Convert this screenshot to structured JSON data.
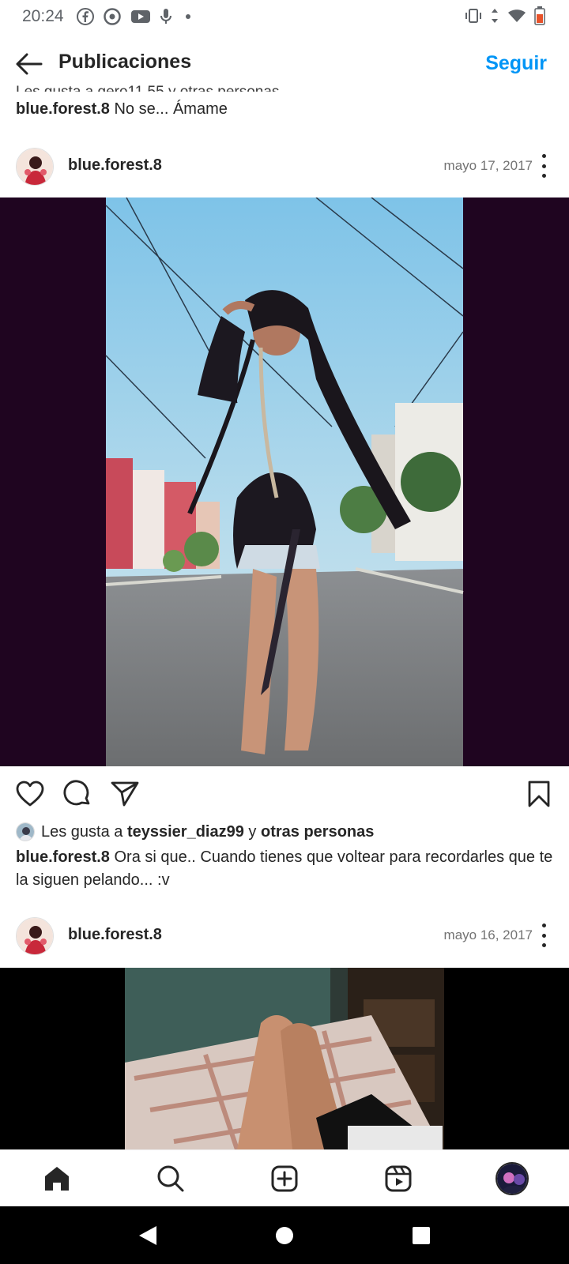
{
  "status_bar": {
    "time": "20:24"
  },
  "header": {
    "title": "Publicaciones",
    "follow_label": "Seguir"
  },
  "prev_post": {
    "likes_text_cut": "Les gusta a gero11.55 y otras personas",
    "caption_user": "blue.forest.8",
    "caption_text": " No se... Ámame"
  },
  "post1": {
    "username": "blue.forest.8",
    "date": "mayo 17, 2017",
    "likes_prefix": "Les gusta a ",
    "likes_user": "teyssier_diaz99",
    "likes_mid": " y ",
    "likes_suffix": "otras personas",
    "caption_user": "blue.forest.8",
    "caption_text": " Ora si que.. Cuando tienes que voltear para recordarles que te la siguen pelando... :v"
  },
  "post2": {
    "username": "blue.forest.8",
    "date": "mayo 16, 2017"
  },
  "icons": {
    "back": "arrow-left-icon",
    "more": "more-vertical-icon",
    "like": "heart-icon",
    "comment": "comment-icon",
    "share": "send-icon",
    "save": "bookmark-icon",
    "home": "home-icon",
    "search": "search-icon",
    "create": "plus-square-icon",
    "reels": "reels-icon"
  },
  "colors": {
    "accent": "#0095f6",
    "text": "#262626",
    "muted": "#737373",
    "post_bg1": "#1f0520",
    "post_bg2": "#000000"
  }
}
